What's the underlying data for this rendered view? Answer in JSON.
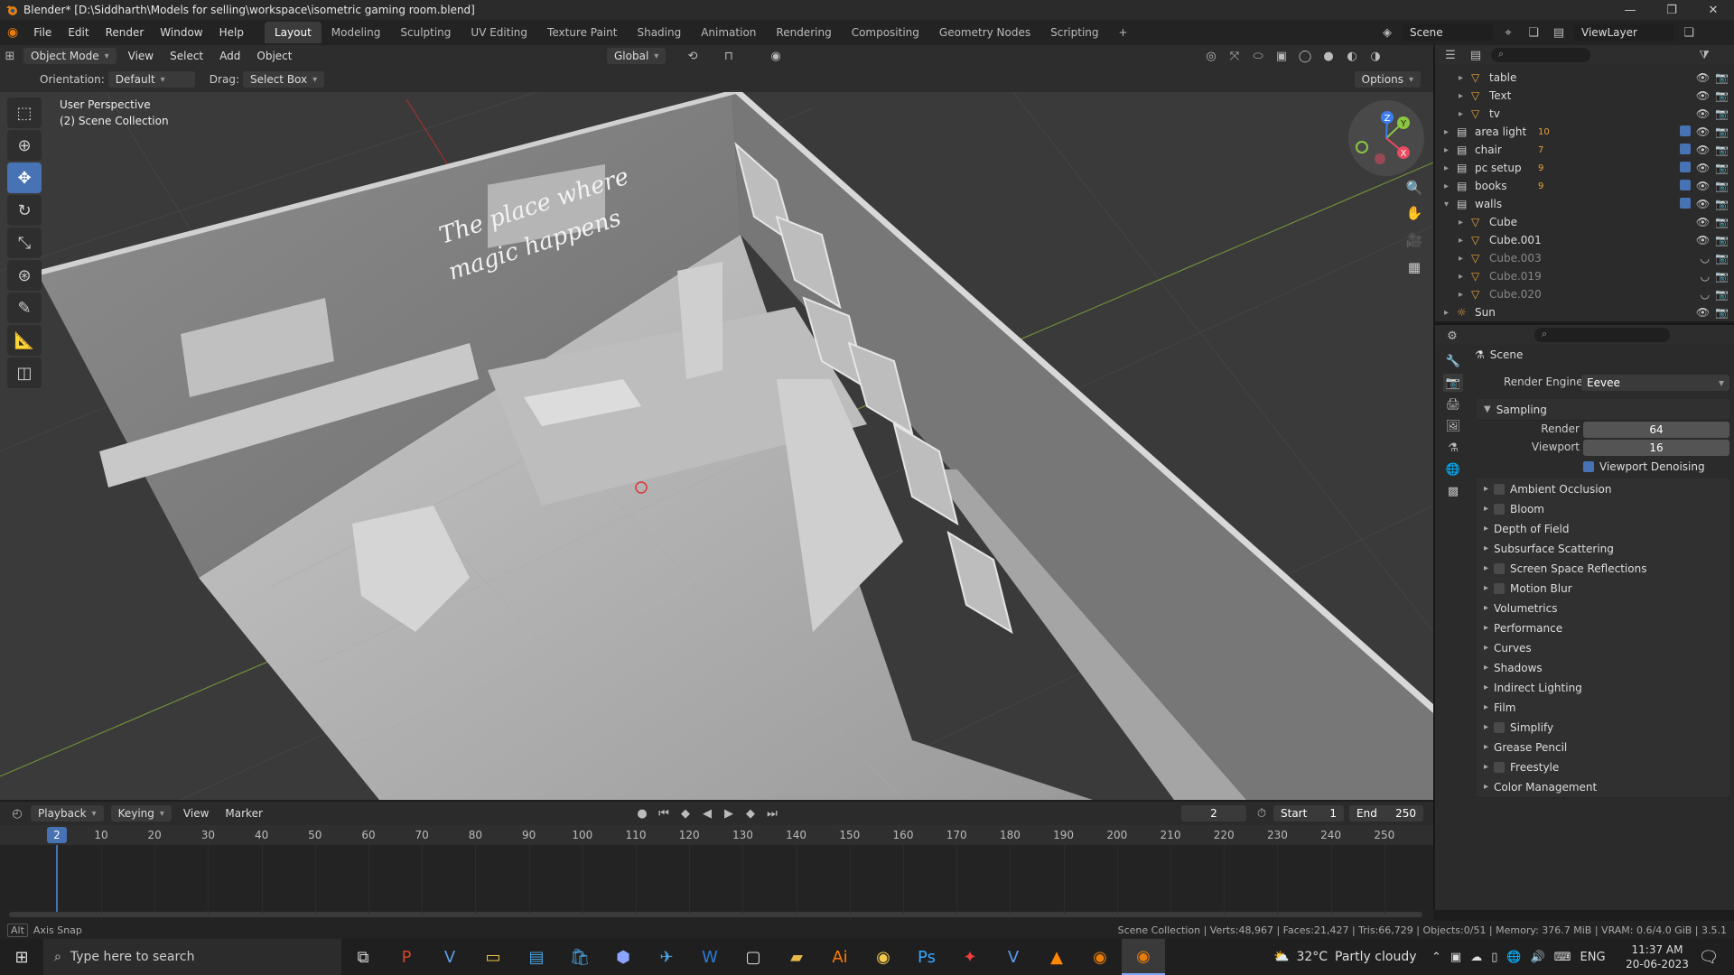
{
  "title_bar": {
    "text": "Blender* [D:\\Siddharth\\Models for selling\\workspace\\isometric gaming room.blend]"
  },
  "menus": [
    "File",
    "Edit",
    "Render",
    "Window",
    "Help"
  ],
  "workspaces": [
    "Layout",
    "Modeling",
    "Sculpting",
    "UV Editing",
    "Texture Paint",
    "Shading",
    "Animation",
    "Rendering",
    "Compositing",
    "Geometry Nodes",
    "Scripting"
  ],
  "active_workspace": "Layout",
  "scene_name": "Scene",
  "view_layer": "ViewLayer",
  "viewport_header": {
    "mode": "Object Mode",
    "menus": [
      "View",
      "Select",
      "Add",
      "Object"
    ],
    "transform": "Global",
    "orientation_label": "Orientation:",
    "orientation": "Default",
    "drag_label": "Drag:",
    "drag": "Select Box",
    "options": "Options"
  },
  "viewport": {
    "view_name": "User Perspective",
    "collection": "(2) Scene Collection",
    "wall_text_1": "The place where",
    "wall_text_2": "magic happens"
  },
  "outliner": {
    "rows": [
      {
        "name": "table",
        "dim": false,
        "check": false
      },
      {
        "name": "Text",
        "dim": false,
        "check": false
      },
      {
        "name": "tv",
        "dim": false,
        "check": false
      },
      {
        "name": "area light",
        "dim": false,
        "check": true,
        "badge": "10"
      },
      {
        "name": "chair",
        "dim": false,
        "check": true,
        "badge": "7"
      },
      {
        "name": "pc setup",
        "dim": false,
        "check": true,
        "badge": "9"
      },
      {
        "name": "books",
        "dim": false,
        "check": true,
        "badge": "9"
      },
      {
        "name": "walls",
        "dim": false,
        "check": true
      },
      {
        "name": "Cube",
        "dim": false,
        "check": false
      },
      {
        "name": "Cube.001",
        "dim": false,
        "check": false
      },
      {
        "name": "Cube.003",
        "dim": true,
        "check": false
      },
      {
        "name": "Cube.019",
        "dim": true,
        "check": false
      },
      {
        "name": "Cube.020",
        "dim": true,
        "check": false
      },
      {
        "name": "Sun",
        "dim": false,
        "check": false
      }
    ]
  },
  "properties": {
    "context": "Scene",
    "render_engine_label": "Render Engine",
    "render_engine": "Eevee",
    "sampling": {
      "title": "Sampling",
      "render_label": "Render",
      "render": "64",
      "viewport_label": "Viewport",
      "viewport": "16",
      "denoise_label": "Viewport Denoising"
    },
    "panels": [
      {
        "label": "Ambient Occlusion",
        "checkbox": true
      },
      {
        "label": "Bloom",
        "checkbox": true
      },
      {
        "label": "Depth of Field",
        "checkbox": false
      },
      {
        "label": "Subsurface Scattering",
        "checkbox": false
      },
      {
        "label": "Screen Space Reflections",
        "checkbox": true
      },
      {
        "label": "Motion Blur",
        "checkbox": true
      },
      {
        "label": "Volumetrics",
        "checkbox": false
      },
      {
        "label": "Performance",
        "checkbox": false
      },
      {
        "label": "Curves",
        "checkbox": false
      },
      {
        "label": "Shadows",
        "checkbox": false
      },
      {
        "label": "Indirect Lighting",
        "checkbox": false
      },
      {
        "label": "Film",
        "checkbox": false
      },
      {
        "label": "Simplify",
        "checkbox": true
      },
      {
        "label": "Grease Pencil",
        "checkbox": false
      },
      {
        "label": "Freestyle",
        "checkbox": true
      },
      {
        "label": "Color Management",
        "checkbox": false
      }
    ]
  },
  "timeline": {
    "menus": [
      "Playback",
      "Keying",
      "View",
      "Marker"
    ],
    "current_frame": "2",
    "start_label": "Start",
    "start": "1",
    "end_label": "End",
    "end": "250",
    "ticks": [
      "10",
      "20",
      "30",
      "40",
      "50",
      "60",
      "70",
      "80",
      "90",
      "100",
      "110",
      "120",
      "130",
      "140",
      "150",
      "160",
      "170",
      "180",
      "190",
      "200",
      "210",
      "220",
      "230",
      "240",
      "250"
    ]
  },
  "status_bar": {
    "left_key": "Alt",
    "left_text": "Axis Snap",
    "right_text": "Scene Collection | Verts:48,967 | Faces:21,427 | Tris:66,729 | Objects:0/51 | Memory: 376.7 MiB | VRAM: 0.6/4.0 GiB | 3.5.1"
  },
  "taskbar": {
    "search_placeholder": "Type here to search",
    "weather_temp": "32°C",
    "weather_text": "Partly cloudy",
    "language": "ENG",
    "time": "11:37 AM",
    "date": "20-06-2023"
  }
}
